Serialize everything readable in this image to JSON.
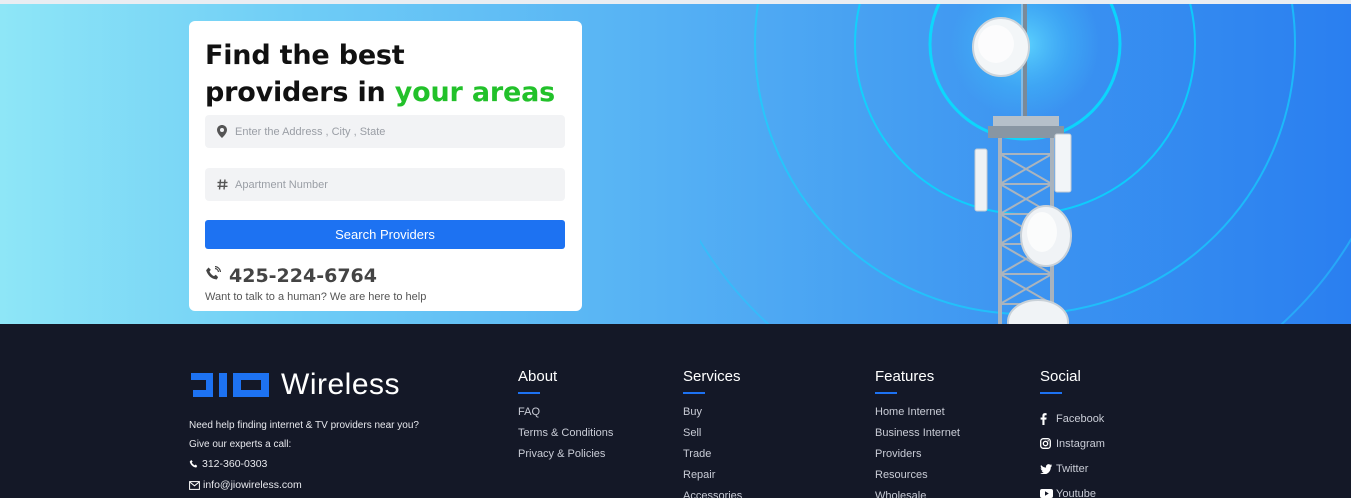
{
  "hero": {
    "heading_line1": "Find the best",
    "heading_line2_plain": "providers in ",
    "heading_line2_accent": "your areas",
    "address_placeholder": "Enter the Address , City , State",
    "apartment_placeholder": "Apartment Number",
    "search_button": "Search Providers",
    "phone": "425-224-6764",
    "phone_subtext": "Want to talk to a human? We are here to help"
  },
  "footer": {
    "logo_mark": "JIO",
    "logo_text": "Wireless",
    "description": "Need help finding internet & TV providers near you? Give our experts a call:",
    "phone": "312-360-0303",
    "email": "info@jiowireless.com",
    "columns": {
      "about": {
        "title": "About",
        "links": [
          "FAQ",
          "Terms & Conditions",
          "Privacy & Policies"
        ]
      },
      "services": {
        "title": "Services",
        "links": [
          "Buy",
          "Sell",
          "Trade",
          "Repair",
          "Accessories"
        ]
      },
      "features": {
        "title": "Features",
        "links": [
          "Home Internet",
          "Business Internet",
          "Providers",
          "Resources",
          "Wholesale"
        ]
      },
      "social": {
        "title": "Social",
        "links": [
          "Facebook",
          "Instagram",
          "Twitter",
          "Youtube"
        ]
      }
    }
  },
  "icons": {
    "address": "location-pin-icon",
    "apartment": "hash-icon",
    "phone": "phone-icon",
    "email": "envelope-icon",
    "facebook": "facebook-icon",
    "instagram": "instagram-icon",
    "twitter": "twitter-icon",
    "youtube": "youtube-icon"
  },
  "colors": {
    "accent_green": "#22c12a",
    "button_blue": "#1d72f2",
    "footer_bg": "#141827"
  }
}
